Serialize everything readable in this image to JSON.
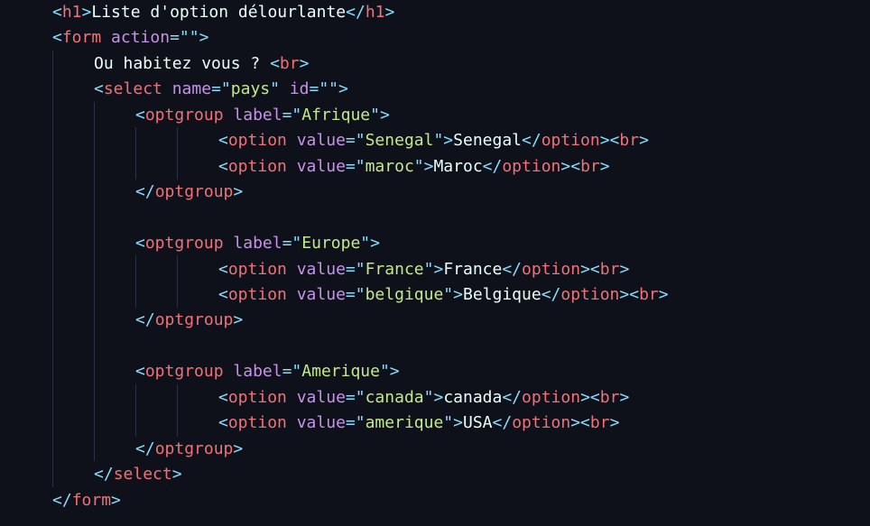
{
  "editor": {
    "theme_colors": {
      "background": "#0f111a",
      "punctuation": "#89ddff",
      "tag": "#f07178",
      "attribute": "#c792ea",
      "string": "#c3e88d",
      "text": "#eeffff"
    },
    "lines": [
      {
        "tokens": [
          {
            "k": "p",
            "v": "<"
          },
          {
            "k": "t",
            "v": "h1"
          },
          {
            "k": "p",
            "v": ">"
          },
          {
            "k": "x",
            "v": "Liste d'option délourlante"
          },
          {
            "k": "p",
            "v": "</"
          },
          {
            "k": "t",
            "v": "h1"
          },
          {
            "k": "p",
            "v": ">"
          }
        ]
      },
      {
        "tokens": [
          {
            "k": "p",
            "v": "<"
          },
          {
            "k": "t",
            "v": "form"
          },
          {
            "k": "x",
            "v": " "
          },
          {
            "k": "a",
            "v": "action"
          },
          {
            "k": "p",
            "v": "=\"\">"
          }
        ]
      },
      {
        "tokens": [
          {
            "k": "x",
            "v": "Ou habitez vous ? "
          },
          {
            "k": "p",
            "v": "<"
          },
          {
            "k": "t",
            "v": "br"
          },
          {
            "k": "p",
            "v": ">"
          }
        ]
      },
      {
        "tokens": [
          {
            "k": "p",
            "v": "<"
          },
          {
            "k": "t",
            "v": "select"
          },
          {
            "k": "x",
            "v": " "
          },
          {
            "k": "a",
            "v": "name"
          },
          {
            "k": "p",
            "v": "=\""
          },
          {
            "k": "s",
            "v": "pays"
          },
          {
            "k": "p",
            "v": "\""
          },
          {
            "k": "x",
            "v": " "
          },
          {
            "k": "a",
            "v": "id"
          },
          {
            "k": "p",
            "v": "=\"\">"
          }
        ]
      },
      {
        "tokens": [
          {
            "k": "p",
            "v": "<"
          },
          {
            "k": "t",
            "v": "optgroup"
          },
          {
            "k": "x",
            "v": " "
          },
          {
            "k": "a",
            "v": "label"
          },
          {
            "k": "p",
            "v": "=\""
          },
          {
            "k": "s",
            "v": "Afrique"
          },
          {
            "k": "p",
            "v": "\">"
          }
        ]
      },
      {
        "tokens": [
          {
            "k": "p",
            "v": "<"
          },
          {
            "k": "t",
            "v": "option"
          },
          {
            "k": "x",
            "v": " "
          },
          {
            "k": "a",
            "v": "value"
          },
          {
            "k": "p",
            "v": "=\""
          },
          {
            "k": "s",
            "v": "Senegal"
          },
          {
            "k": "p",
            "v": "\">"
          },
          {
            "k": "x",
            "v": "Senegal"
          },
          {
            "k": "p",
            "v": "</"
          },
          {
            "k": "t",
            "v": "option"
          },
          {
            "k": "p",
            "v": "><"
          },
          {
            "k": "t",
            "v": "br"
          },
          {
            "k": "p",
            "v": ">"
          }
        ]
      },
      {
        "tokens": [
          {
            "k": "p",
            "v": "<"
          },
          {
            "k": "t",
            "v": "option"
          },
          {
            "k": "x",
            "v": " "
          },
          {
            "k": "a",
            "v": "value"
          },
          {
            "k": "p",
            "v": "=\""
          },
          {
            "k": "s",
            "v": "maroc"
          },
          {
            "k": "p",
            "v": "\">"
          },
          {
            "k": "x",
            "v": "Maroc"
          },
          {
            "k": "p",
            "v": "</"
          },
          {
            "k": "t",
            "v": "option"
          },
          {
            "k": "p",
            "v": "><"
          },
          {
            "k": "t",
            "v": "br"
          },
          {
            "k": "p",
            "v": ">"
          }
        ]
      },
      {
        "tokens": [
          {
            "k": "p",
            "v": "</"
          },
          {
            "k": "t",
            "v": "optgroup"
          },
          {
            "k": "p",
            "v": ">"
          }
        ]
      },
      {
        "tokens": []
      },
      {
        "tokens": [
          {
            "k": "p",
            "v": "<"
          },
          {
            "k": "t",
            "v": "optgroup"
          },
          {
            "k": "x",
            "v": " "
          },
          {
            "k": "a",
            "v": "label"
          },
          {
            "k": "p",
            "v": "=\""
          },
          {
            "k": "s",
            "v": "Europe"
          },
          {
            "k": "p",
            "v": "\">"
          }
        ]
      },
      {
        "tokens": [
          {
            "k": "p",
            "v": "<"
          },
          {
            "k": "t",
            "v": "option"
          },
          {
            "k": "x",
            "v": " "
          },
          {
            "k": "a",
            "v": "value"
          },
          {
            "k": "p",
            "v": "=\""
          },
          {
            "k": "s",
            "v": "France"
          },
          {
            "k": "p",
            "v": "\">"
          },
          {
            "k": "x",
            "v": "France"
          },
          {
            "k": "p",
            "v": "</"
          },
          {
            "k": "t",
            "v": "option"
          },
          {
            "k": "p",
            "v": "><"
          },
          {
            "k": "t",
            "v": "br"
          },
          {
            "k": "p",
            "v": ">"
          }
        ]
      },
      {
        "tokens": [
          {
            "k": "p",
            "v": "<"
          },
          {
            "k": "t",
            "v": "option"
          },
          {
            "k": "x",
            "v": " "
          },
          {
            "k": "a",
            "v": "value"
          },
          {
            "k": "p",
            "v": "=\""
          },
          {
            "k": "s",
            "v": "belgique"
          },
          {
            "k": "p",
            "v": "\">"
          },
          {
            "k": "x",
            "v": "Belgique"
          },
          {
            "k": "p",
            "v": "</"
          },
          {
            "k": "t",
            "v": "option"
          },
          {
            "k": "p",
            "v": "><"
          },
          {
            "k": "t",
            "v": "br"
          },
          {
            "k": "p",
            "v": ">"
          }
        ]
      },
      {
        "tokens": [
          {
            "k": "p",
            "v": "</"
          },
          {
            "k": "t",
            "v": "optgroup"
          },
          {
            "k": "p",
            "v": ">"
          }
        ]
      },
      {
        "tokens": []
      },
      {
        "tokens": [
          {
            "k": "p",
            "v": "<"
          },
          {
            "k": "t",
            "v": "optgroup"
          },
          {
            "k": "x",
            "v": " "
          },
          {
            "k": "a",
            "v": "label"
          },
          {
            "k": "p",
            "v": "=\""
          },
          {
            "k": "s",
            "v": "Amerique"
          },
          {
            "k": "p",
            "v": "\">"
          }
        ]
      },
      {
        "tokens": [
          {
            "k": "p",
            "v": "<"
          },
          {
            "k": "t",
            "v": "option"
          },
          {
            "k": "x",
            "v": " "
          },
          {
            "k": "a",
            "v": "value"
          },
          {
            "k": "p",
            "v": "=\""
          },
          {
            "k": "s",
            "v": "canada"
          },
          {
            "k": "p",
            "v": "\">"
          },
          {
            "k": "x",
            "v": "canada"
          },
          {
            "k": "p",
            "v": "</"
          },
          {
            "k": "t",
            "v": "option"
          },
          {
            "k": "p",
            "v": "><"
          },
          {
            "k": "t",
            "v": "br"
          },
          {
            "k": "p",
            "v": ">"
          }
        ]
      },
      {
        "tokens": [
          {
            "k": "p",
            "v": "<"
          },
          {
            "k": "t",
            "v": "option"
          },
          {
            "k": "x",
            "v": " "
          },
          {
            "k": "a",
            "v": "value"
          },
          {
            "k": "p",
            "v": "=\""
          },
          {
            "k": "s",
            "v": "amerique"
          },
          {
            "k": "p",
            "v": "\">"
          },
          {
            "k": "x",
            "v": "USA"
          },
          {
            "k": "p",
            "v": "</"
          },
          {
            "k": "t",
            "v": "option"
          },
          {
            "k": "p",
            "v": "><"
          },
          {
            "k": "t",
            "v": "br"
          },
          {
            "k": "p",
            "v": ">"
          }
        ]
      },
      {
        "tokens": [
          {
            "k": "p",
            "v": "</"
          },
          {
            "k": "t",
            "v": "optgroup"
          },
          {
            "k": "p",
            "v": ">"
          }
        ]
      },
      {
        "tokens": [
          {
            "k": "p",
            "v": "</"
          },
          {
            "k": "t",
            "v": "select"
          },
          {
            "k": "p",
            "v": ">"
          }
        ]
      },
      {
        "tokens": [
          {
            "k": "p",
            "v": "</"
          },
          {
            "k": "t",
            "v": "form"
          },
          {
            "k": "p",
            "v": ">"
          }
        ]
      }
    ]
  }
}
